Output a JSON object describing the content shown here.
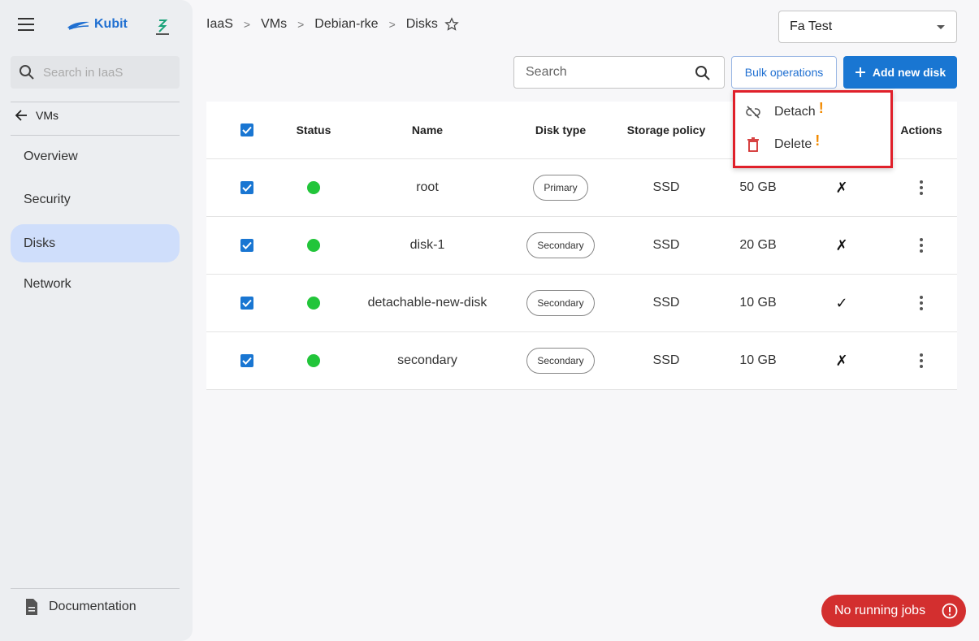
{
  "sidebar": {
    "brand": "Kubit",
    "search_placeholder": "Search in IaaS",
    "back_label": "VMs",
    "items": [
      {
        "label": "Overview",
        "active": false
      },
      {
        "label": "Security",
        "active": false
      },
      {
        "label": "Disks",
        "active": true
      },
      {
        "label": "Network",
        "active": false
      }
    ],
    "documentation": "Documentation"
  },
  "header": {
    "breadcrumb": [
      "IaaS",
      "VMs",
      "Debian-rke",
      "Disks"
    ],
    "tenant": "Fa Test"
  },
  "toolbar": {
    "search_placeholder": "Search",
    "bulk_label": "Bulk operations",
    "add_label": "Add new disk"
  },
  "table": {
    "columns": {
      "status": "Status",
      "name": "Name",
      "disk_type": "Disk type",
      "storage_policy": "Storage policy",
      "actions": "Actions"
    },
    "rows": [
      {
        "name": "root",
        "type": "Primary",
        "storage": "SSD",
        "size": "50 GB",
        "flag": "✗"
      },
      {
        "name": "disk-1",
        "type": "Secondary",
        "storage": "SSD",
        "size": "20 GB",
        "flag": "✗"
      },
      {
        "name": "detachable-new-disk",
        "type": "Secondary",
        "storage": "SSD",
        "size": "10 GB",
        "flag": "✓"
      },
      {
        "name": "secondary",
        "type": "Secondary",
        "storage": "SSD",
        "size": "10 GB",
        "flag": "✗"
      }
    ]
  },
  "bulk_menu": {
    "detach": "Detach",
    "delete": "Delete",
    "warn_mark": "!"
  },
  "jobs": {
    "label": "No running jobs"
  },
  "colors": {
    "accent": "#1976d2",
    "active_nav": "#cfdefb",
    "status_ok": "#22c53a",
    "danger": "#d32f2f",
    "warning": "#f28a00",
    "highlight_border": "#e0202a"
  }
}
